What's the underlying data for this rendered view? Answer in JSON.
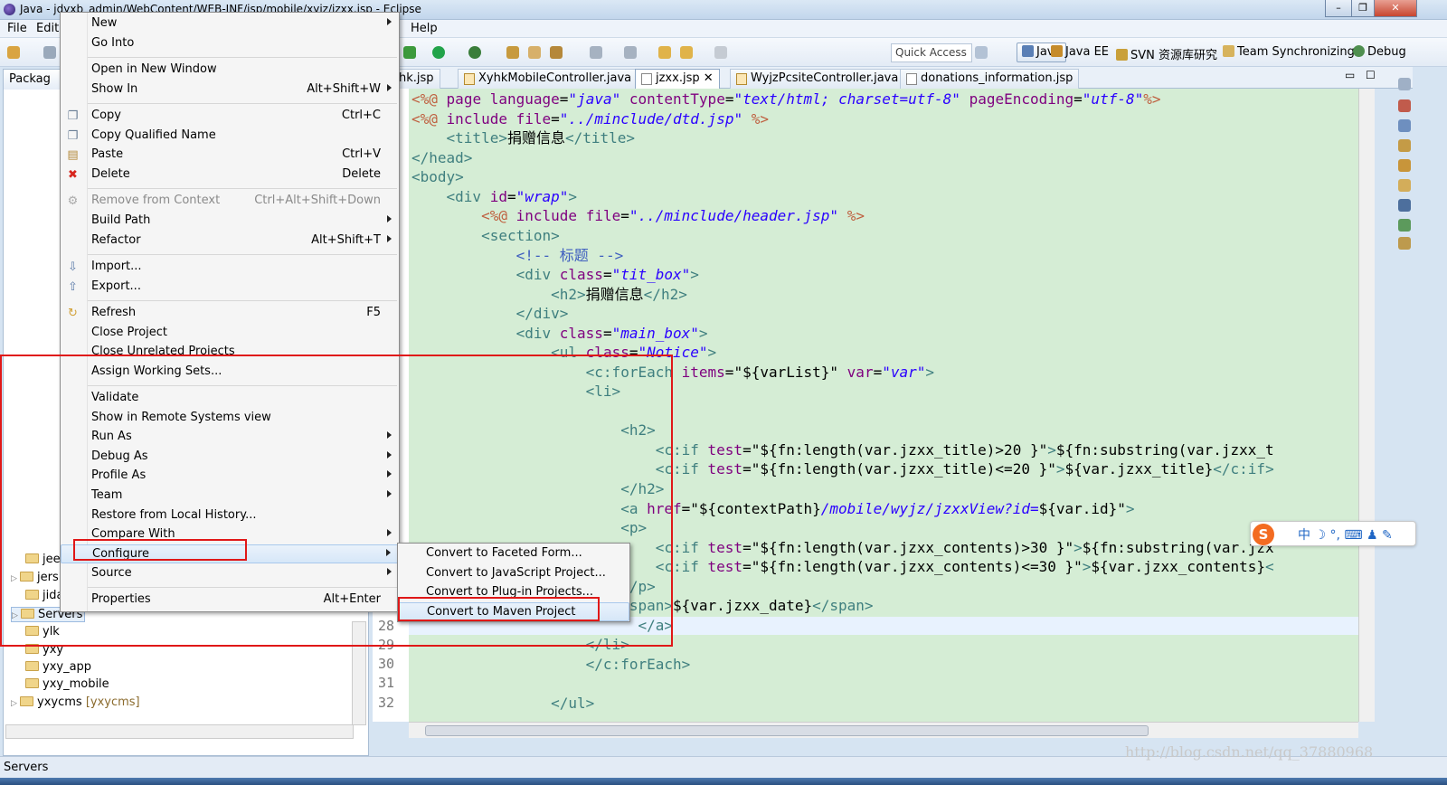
{
  "window": {
    "title": "Java - jdyxb_admin/WebContent/WEB-INF/jsp/mobile/xyjz/jzxx.jsp - Eclipse"
  },
  "menubar": {
    "items": [
      "File",
      "Edit",
      "Help"
    ]
  },
  "toolbar": {
    "quick_access": "Quick Access",
    "perspectives": [
      "Java",
      "Java EE",
      "SVN 资源库研究",
      "Team Synchronizing",
      "Debug"
    ]
  },
  "package_explorer": {
    "tab": "Packag",
    "items": [
      {
        "label": "jeef",
        "decor": "",
        "expandable": false
      },
      {
        "label": "jers",
        "decor": "",
        "expandable": true
      },
      {
        "label": "jida",
        "decor": "",
        "expandable": false
      },
      {
        "label": "Servers",
        "decor": "",
        "expandable": true
      },
      {
        "label": "ylk",
        "decor": "",
        "expandable": false
      },
      {
        "label": "yxy",
        "decor": "",
        "expandable": false
      },
      {
        "label": "yxy_app",
        "decor": "",
        "expandable": false
      },
      {
        "label": "yxy_mobile",
        "decor": "",
        "expandable": false
      },
      {
        "label": "yxycms",
        "decor": "[yxycms]",
        "expandable": true
      }
    ]
  },
  "editor": {
    "tabs": [
      "hk.jsp",
      "XyhkMobileController.java",
      "jzxx.jsp",
      "WyjzPcsiteController.java",
      "donations_information.jsp"
    ],
    "line_numbers": [
      "28",
      "29",
      "30",
      "31",
      "32"
    ]
  },
  "context_menu": {
    "items": {
      "new": {
        "label": "New"
      },
      "go_into": {
        "label": "Go Into"
      },
      "open_new_window": {
        "label": "Open in New Window"
      },
      "show_in": {
        "label": "Show In",
        "shortcut": "Alt+Shift+W"
      },
      "copy": {
        "label": "Copy",
        "shortcut": "Ctrl+C"
      },
      "copy_qualified": {
        "label": "Copy Qualified Name"
      },
      "paste": {
        "label": "Paste",
        "shortcut": "Ctrl+V"
      },
      "delete": {
        "label": "Delete",
        "shortcut": "Delete"
      },
      "remove_context": {
        "label": "Remove from Context",
        "shortcut": "Ctrl+Alt+Shift+Down"
      },
      "build_path": {
        "label": "Build Path"
      },
      "refactor": {
        "label": "Refactor",
        "shortcut": "Alt+Shift+T"
      },
      "import": {
        "label": "Import..."
      },
      "export": {
        "label": "Export..."
      },
      "refresh": {
        "label": "Refresh",
        "shortcut": "F5"
      },
      "close_project": {
        "label": "Close Project"
      },
      "close_unrelated": {
        "label": "Close Unrelated Projects"
      },
      "assign_working_sets": {
        "label": "Assign Working Sets..."
      },
      "validate": {
        "label": "Validate"
      },
      "show_remote": {
        "label": "Show in Remote Systems view"
      },
      "run_as": {
        "label": "Run As"
      },
      "debug_as": {
        "label": "Debug As"
      },
      "profile_as": {
        "label": "Profile As"
      },
      "team": {
        "label": "Team"
      },
      "restore_history": {
        "label": "Restore from Local History..."
      },
      "compare_with": {
        "label": "Compare With"
      },
      "configure": {
        "label": "Configure"
      },
      "source": {
        "label": "Source"
      },
      "properties": {
        "label": "Properties",
        "shortcut": "Alt+Enter"
      }
    }
  },
  "submenu": {
    "items": [
      "Convert to Faceted Form...",
      "Convert to JavaScript Project...",
      "Convert to Plug-in Projects...",
      "Convert to Maven Project"
    ]
  },
  "status_bar": {
    "text": "Servers"
  },
  "ime": {
    "text": "中 ☽ °, ⌨ ♟ ✎"
  },
  "watermark": "http://blog.csdn.net/qq_37880968"
}
